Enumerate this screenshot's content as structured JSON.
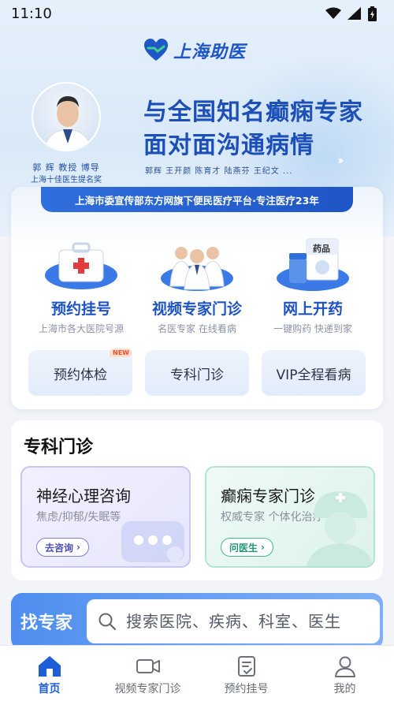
{
  "status_bar": {
    "time": "11:10",
    "icons": [
      "wifi-icon",
      "cellular-signal-icon",
      "battery-charging-icon"
    ]
  },
  "brand": {
    "name": "上海助医",
    "color": "#1f56c8"
  },
  "hero": {
    "doctor_name": "郭 辉 教授 博导",
    "doctor_award": "上海十佳医生提名奖",
    "headline_line1": "与全国知名癫痫专家",
    "headline_line2": "面对面沟通病情",
    "experts": "郭辉  王开颜  陈育才  陆燕芬  王纪文 ..."
  },
  "banner": {
    "text": "上海市委宣传部东方网旗下便民医疗平台·专注医疗23年"
  },
  "services": [
    {
      "title": "预约挂号",
      "subtitle": "上海市各大医院号源",
      "icon": "first-aid-kit-icon"
    },
    {
      "title": "视频专家门诊",
      "subtitle": "名医专家 在线看病",
      "icon": "doctors-group-icon"
    },
    {
      "title": "网上开药",
      "subtitle": "一键购药 快递到家",
      "icon": "medicine-box-icon",
      "box_label": "药品"
    }
  ],
  "quick_links": [
    {
      "label": "预约体检",
      "badge": "NEW"
    },
    {
      "label": "专科门诊"
    },
    {
      "label": "VIP全程看病"
    }
  ],
  "specialty": {
    "title": "专科门诊",
    "cards": [
      {
        "title": "神经心理咨询",
        "subtitle": "焦虑/抑郁/失眠等",
        "button": "去咨询"
      },
      {
        "title": "癫痫专家门诊",
        "subtitle": "权威专家 个体化治疗",
        "button": "问医生"
      }
    ]
  },
  "finder": {
    "label": "找专家",
    "placeholder": "搜索医院、疾病、科室、医生"
  },
  "tabs": [
    {
      "label": "首页",
      "icon": "home-icon",
      "active": true
    },
    {
      "label": "视频专家门诊",
      "icon": "video-camera-icon",
      "active": false
    },
    {
      "label": "预约挂号",
      "icon": "register-form-icon",
      "active": false
    },
    {
      "label": "我的",
      "icon": "user-icon",
      "active": false
    }
  ],
  "colors": {
    "accent": "#1d5fd6",
    "green": "#23946f",
    "purple": "#4b4fb5"
  }
}
